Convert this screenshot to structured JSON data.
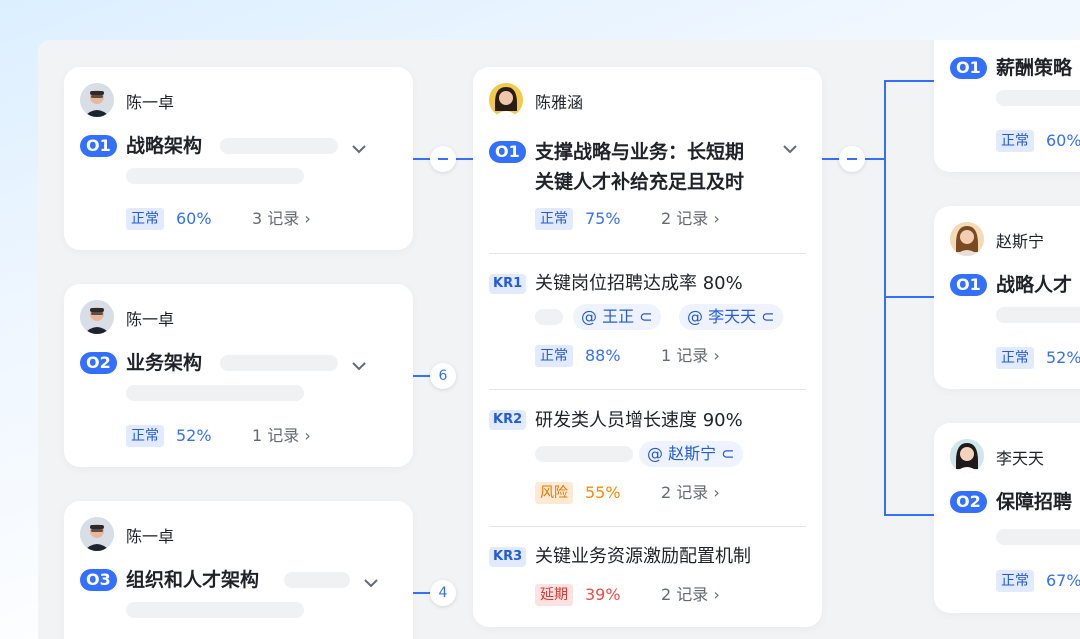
{
  "left_cards": [
    {
      "owner": "陈一卓",
      "badge": "O1",
      "title": "战略架构",
      "status": "正常",
      "percent": "60%",
      "records": "3 记录",
      "child_count": ""
    },
    {
      "owner": "陈一卓",
      "badge": "O2",
      "title": "业务架构",
      "status": "正常",
      "percent": "52%",
      "records": "1 记录",
      "child_count": "6"
    },
    {
      "owner": "陈一卓",
      "badge": "O3",
      "title": "组织和人才架构",
      "status": "",
      "percent": "",
      "records": "",
      "child_count": "4"
    }
  ],
  "center_card": {
    "owner": "陈雅涵",
    "objective": {
      "badge": "O1",
      "title_line1": "支撑战略与业务：长短期",
      "title_line2": "关键人才补给充足且及时",
      "status": "正常",
      "percent": "75%",
      "records": "2 记录"
    },
    "key_results": [
      {
        "badge": "KR1",
        "title": "关键岗位招聘达成率 80%",
        "mentions": [
          "@ 王正",
          "@ 李天天"
        ],
        "status": "正常",
        "status_type": "normal",
        "percent": "88%",
        "records": "1 记录"
      },
      {
        "badge": "KR2",
        "title": "研发类人员增长速度 90%",
        "mentions": [
          "@ 赵斯宁"
        ],
        "status": "风险",
        "status_type": "risk",
        "percent": "55%",
        "records": "2 记录"
      },
      {
        "badge": "KR3",
        "title": "关键业务资源激励配置机制",
        "mentions": [],
        "status": "延期",
        "status_type": "delay",
        "percent": "39%",
        "records": "2 记录"
      }
    ]
  },
  "right_cards": [
    {
      "owner": "",
      "badge": "O1",
      "title": "薪酬策略",
      "status": "正常",
      "percent": "60%"
    },
    {
      "owner": "赵斯宁",
      "badge": "O1",
      "title": "战略人才",
      "status": "正常",
      "percent": "52%"
    },
    {
      "owner": "李天天",
      "badge": "O2",
      "title": "保障招聘",
      "status": "正常",
      "percent": "67%"
    }
  ],
  "colors": {
    "accent": "#3370ff",
    "normal": "#3370ff",
    "risk": "#ff8800",
    "delay": "#f54a45"
  },
  "icons": {
    "chevron": "chevron-down-icon",
    "records_arrow": "chevron-right-icon",
    "mention_link": "link-icon"
  }
}
